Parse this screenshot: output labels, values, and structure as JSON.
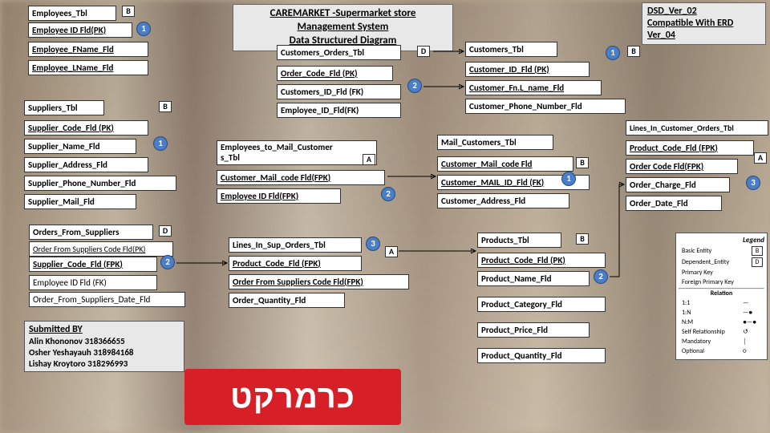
{
  "header": {
    "title_l1": "CAREMARKET -Supermarket store Management System",
    "title_l2": "Data Structured Diagram",
    "ver_l1": "DSD_Ver_02",
    "ver_l2": "Compatible With ERD",
    "ver_l3": "Ver_04"
  },
  "tables": {
    "employees": {
      "name": "Employees_Tbl",
      "f1": "Employee ID Fld(PK)",
      "f2": "Employee_FName_Fld",
      "f3": "Employee_LName_Fld"
    },
    "suppliers": {
      "name": "Suppliers_Tbl",
      "f1": "Supplier_Code_Fld (PK)",
      "f2": "Supplier_Name_Fld",
      "f3": "Supplier_Address_Fld",
      "f4": "Supplier_Phone_Number_Fld",
      "f5": "Supplier_Mail_Fld"
    },
    "orders_from_suppliers": {
      "name": "Orders_From_Suppliers",
      "f1": "Order From Suppliers Code Fld(PK)",
      "f2": "Supplier_Code_Fld (FPK)",
      "f3": "Employee ID Fld (FK)",
      "f4": "Order_From_Suppliers_Date_Fld"
    },
    "customers_orders": {
      "name": "Customers_Orders_Tbl",
      "f1": "Order_Code_Fld (PK)",
      "f2": "Customers_ID_Fld (FK)",
      "f3": "Employee_ID_Fld(FK)"
    },
    "emp_to_mail": {
      "name_l1": "Employees_to_Mail_Customer",
      "name_l2": "s_Tbl",
      "f1": "Customer_Mail_code Fld(FPK)",
      "f2": "Employee ID Fld(FPK)"
    },
    "lines_sup": {
      "name": "Lines_In_Sup_Orders_Tbl",
      "f1": "Product_Code_Fld (FPK)",
      "f2": "Order From Suppliers Code Fld(FPK)",
      "f3": "Order_Quantity_Fld"
    },
    "customers": {
      "name": "Customers_Tbl",
      "f1": "Customer_ID_Fld (PK)",
      "f2": "Customer_Fn.L_name_Fld",
      "f3": "Customer_Phone_Number_Fld"
    },
    "mail_cust": {
      "name": "Mail_Customers_Tbl",
      "f1": "Customer_Mail_code Fld",
      "f2": "Customer_MAIL_ID_Fld (FK)",
      "f3": "Customer_Address_Fld"
    },
    "products": {
      "name": "Products_Tbl",
      "f1": "Product_Code_Fld (PK)",
      "f2": "Product_Name_Fld",
      "f3": "Product_Category_Fld",
      "f4": "Product_Price_Fld",
      "f5": "Product_Quantity_Fld"
    },
    "lines_cust": {
      "name": "Lines_In_Customer_Orders_Tbl",
      "f1": "Product_Code_Fld (FPK)",
      "f2": "Order Code Fld(FPK)",
      "f3": "Order_Charge_Fld",
      "f4": "Order_Date_Fld"
    }
  },
  "submitted": {
    "heading": "Submitted BY",
    "a1": "Alin Khononov 318366655",
    "a2": "Osher Yeshayauh 318984168",
    "a3": "Lishay Kroytoro 318296993"
  },
  "legend": {
    "title": "Legend",
    "r1a": "Basic Entity",
    "r1b": "B",
    "r2a": "Dependent_Entity",
    "r2b": "D",
    "r3a": "Primary Key",
    "r4a": "Foreign Primary Key",
    "rel": "Relation",
    "c1": "1:1",
    "c2": "1:N",
    "c3": "N:M",
    "s1": "Self Relationship",
    "s2": "Mandatory",
    "s3": "Optional"
  },
  "banner": "כרמרקט"
}
